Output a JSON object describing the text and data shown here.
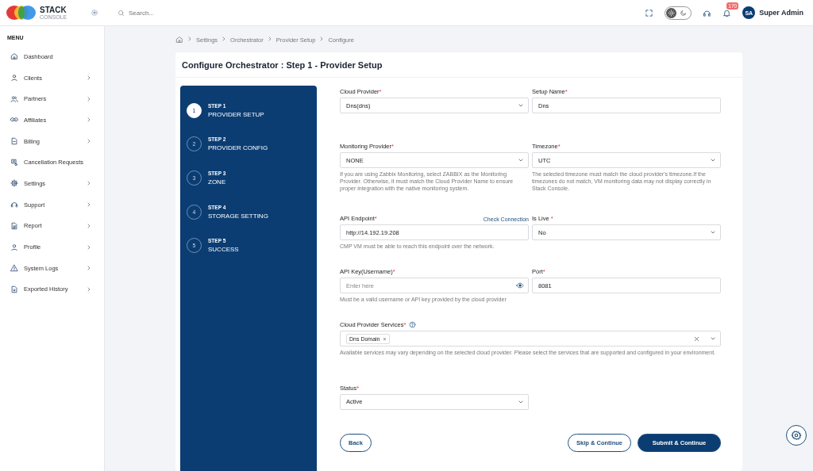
{
  "brand": {
    "name": "STACK",
    "subtitle": "CONSOLE"
  },
  "search": {
    "placeholder": "Search..."
  },
  "topbar": {
    "dark_mode": false,
    "notification_count": "170",
    "avatar": "SA",
    "user": "Super Admin"
  },
  "sidebar": {
    "heading": "MENU",
    "items": [
      {
        "label": "Dashboard",
        "has_submenu": false
      },
      {
        "label": "Clients",
        "has_submenu": true
      },
      {
        "label": "Partners",
        "has_submenu": true
      },
      {
        "label": "Affiliates",
        "has_submenu": true
      },
      {
        "label": "Billing",
        "has_submenu": true
      },
      {
        "label": "Cancellation Requests",
        "has_submenu": false
      },
      {
        "label": "Settings",
        "has_submenu": true
      },
      {
        "label": "Support",
        "has_submenu": true
      },
      {
        "label": "Report",
        "has_submenu": true
      },
      {
        "label": "Profile",
        "has_submenu": true
      },
      {
        "label": "System Logs",
        "has_submenu": true
      },
      {
        "label": "Exported History",
        "has_submenu": true
      }
    ]
  },
  "breadcrumb": [
    "Settings",
    "Orchestrator",
    "Provider Setup",
    "Configure"
  ],
  "title": "Configure Orchestrator : Step 1 - Provider Setup",
  "steps": [
    {
      "number": "1",
      "step": "STEP 1",
      "name": "PROVIDER SETUP",
      "selected": true
    },
    {
      "number": "2",
      "step": "STEP 2",
      "name": "PROVIDER CONFIG",
      "selected": false
    },
    {
      "number": "3",
      "step": "STEP 3",
      "name": "ZONE",
      "selected": false
    },
    {
      "number": "4",
      "step": "STEP 4",
      "name": "STORAGE SETTING",
      "selected": false
    },
    {
      "number": "5",
      "step": "STEP 5",
      "name": "SUCCESS",
      "selected": false
    }
  ],
  "form_rows": [
    {
      "fields": [
        {
          "kind": "select",
          "label": "Cloud Provider",
          "mark": "*",
          "value": "Dns(dns)"
        },
        {
          "kind": "text",
          "label": "Setup Name",
          "mark": "*",
          "value": "Dns"
        }
      ]
    },
    {
      "fields": [
        {
          "kind": "select",
          "label": "Monitoring Provider",
          "mark": "*",
          "value": "NONE",
          "help": "If you are using Zabbix Monitoring, select ZABBIX as the Monitoring Provider. Otherwise, it must match the Cloud Provider Name to ensure proper integration with the native monitoring system."
        },
        {
          "kind": "select",
          "label": "Timezone",
          "mark": "*",
          "value": "UTC",
          "help": "The selected timezone must match the cloud provider's timezone.If the timezones do not match, VM monitoring data may not display correctly in Stack Console."
        }
      ]
    },
    {
      "fields": [
        {
          "kind": "text",
          "label": "API Endpoint",
          "mark": "*",
          "value": "http://14.192.19.208",
          "link": "Check Connection",
          "help": "CMP VM must be able to reach this endpoint over the network."
        },
        {
          "kind": "select",
          "label": "Is Live ",
          "mark": "*",
          "value": "No"
        }
      ]
    },
    {
      "fields": [
        {
          "kind": "password",
          "label": "API Key(Username)",
          "mark": "*",
          "placeholder": "Enter here",
          "help": "Must be a valid username or API key provided by the cloud provider"
        },
        {
          "kind": "text",
          "label": "Port",
          "mark": "*",
          "value": "8081"
        }
      ]
    },
    {
      "fields": [
        {
          "kind": "multiselect",
          "label": "Cloud Provider Services",
          "mark": "*",
          "tags": [
            {
              "label": "Dns Domain",
              "remove": "×"
            }
          ],
          "help": "Available services may vary depending on the selected cloud provider. Please select the services that are supported and configured in your environment."
        }
      ]
    },
    {
      "fields": [
        {
          "kind": "select",
          "label": "Status",
          "mark": "*",
          "value": "Active"
        }
      ]
    }
  ],
  "buttons": {
    "back": "Back",
    "skip": "Skip & Continue",
    "submit": "Submit & Continue"
  }
}
